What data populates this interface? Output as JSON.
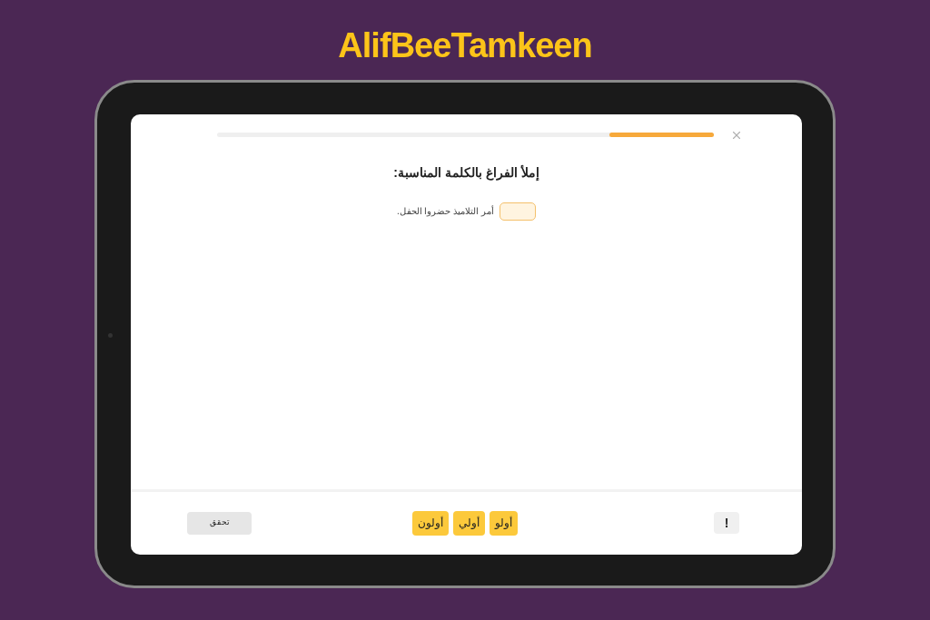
{
  "logo": "AlifBeeTamkeen",
  "progress": {
    "level": 0.21
  },
  "question": "إملأ الفراغ بالكلمة المناسبة:",
  "sentence": "أمر التلاميذ حضروا الحفل.",
  "options": [
    "أولو",
    "أولي",
    "أولون"
  ],
  "hint_button": "!",
  "check_button": "تحقق"
}
